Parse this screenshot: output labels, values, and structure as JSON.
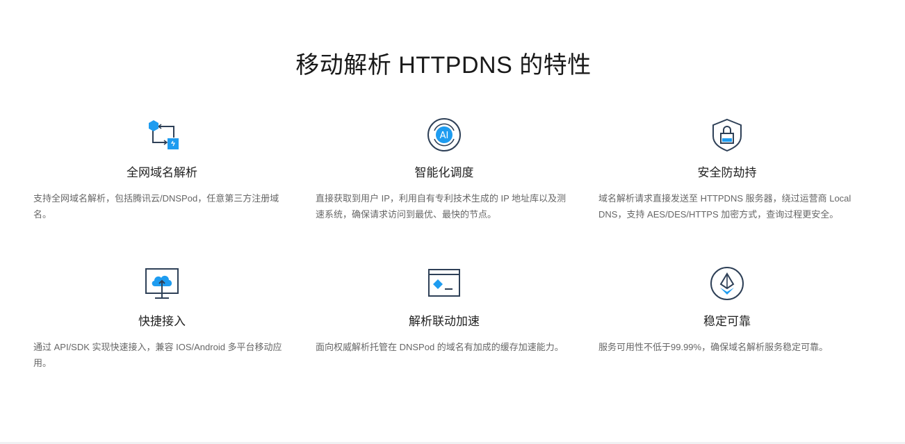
{
  "section": {
    "title": "移动解析 HTTPDNS 的特性"
  },
  "colors": {
    "accent": "#1e9cf0",
    "stroke": "#2e4057",
    "title": "#1a1a1a",
    "text": "#666666"
  },
  "features": [
    {
      "icon": "domain-sync-icon",
      "title": "全网域名解析",
      "desc": "支持全网域名解析，包括腾讯云/DNSPod，任意第三方注册域名。"
    },
    {
      "icon": "ai-icon",
      "title": "智能化调度",
      "desc": "直接获取到用户 IP，利用自有专利技术生成的 IP 地址库以及测速系统，确保请求访问到最优、最快的节点。"
    },
    {
      "icon": "shield-lock-icon",
      "title": "安全防劫持",
      "desc": "域名解析请求直接发送至 HTTPDNS 服务器，绕过运营商 Local DNS，支持 AES/DES/HTTPS 加密方式，查询过程更安全。"
    },
    {
      "icon": "cloud-upload-monitor-icon",
      "title": "快捷接入",
      "desc": "通过 API/SDK 实现快速接入，兼容 IOS/Android 多平台移动应用。"
    },
    {
      "icon": "terminal-window-icon",
      "title": "解析联动加速",
      "desc": "面向权威解析托管在 DNSPod 的域名有加成的缓存加速能力。"
    },
    {
      "icon": "stable-layers-icon",
      "title": "稳定可靠",
      "desc": "服务可用性不低于99.99%，确保域名解析服务稳定可靠。"
    }
  ]
}
